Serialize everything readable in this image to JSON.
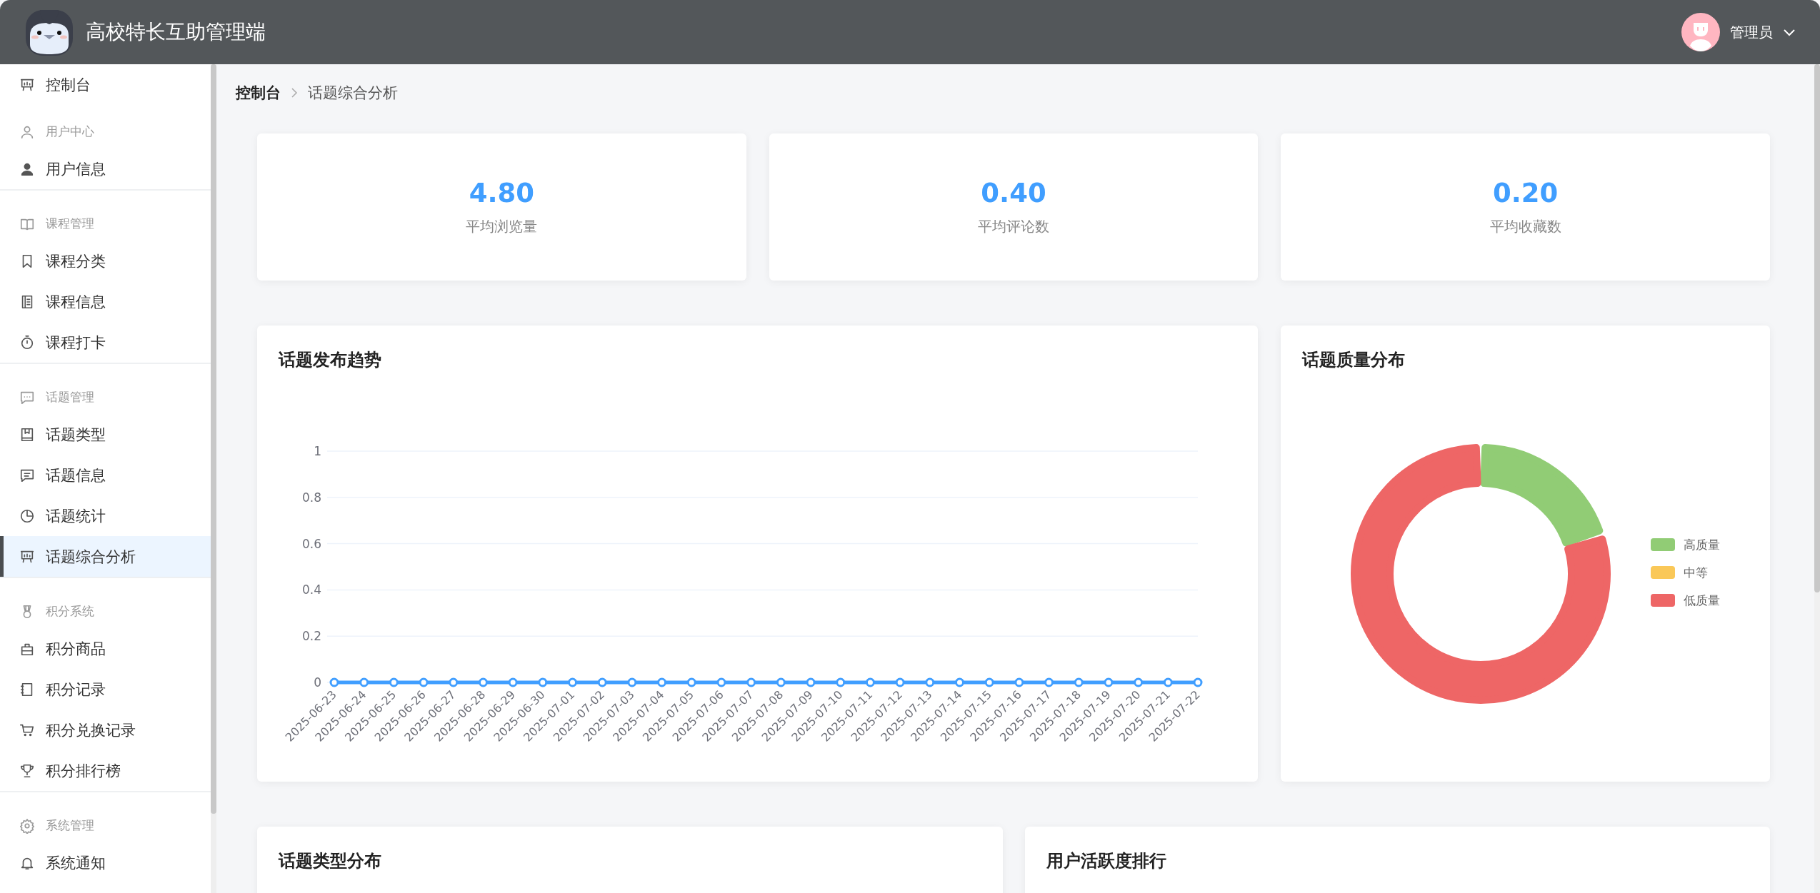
{
  "header": {
    "title": "高校特长互助管理端",
    "user": {
      "name": "管理员"
    }
  },
  "sidebar": {
    "items": [
      {
        "kind": "item",
        "label": "控制台",
        "selected": false
      },
      {
        "kind": "group",
        "label": "用户中心",
        "children": [
          {
            "label": "用户信息",
            "selected": false
          }
        ]
      },
      {
        "kind": "group",
        "label": "课程管理",
        "children": [
          {
            "label": "课程分类",
            "selected": false
          },
          {
            "label": "课程信息",
            "selected": false
          },
          {
            "label": "课程打卡",
            "selected": false
          }
        ]
      },
      {
        "kind": "group",
        "label": "话题管理",
        "children": [
          {
            "label": "话题类型",
            "selected": false
          },
          {
            "label": "话题信息",
            "selected": false
          },
          {
            "label": "话题统计",
            "selected": false
          },
          {
            "label": "话题综合分析",
            "selected": true
          }
        ]
      },
      {
        "kind": "group",
        "label": "积分系统",
        "children": [
          {
            "label": "积分商品",
            "selected": false
          },
          {
            "label": "积分记录",
            "selected": false
          },
          {
            "label": "积分兑换记录",
            "selected": false
          },
          {
            "label": "积分排行榜",
            "selected": false
          }
        ]
      },
      {
        "kind": "group",
        "label": "系统管理",
        "children": [
          {
            "label": "系统通知",
            "selected": false
          }
        ]
      }
    ]
  },
  "breadcrumb": [
    "控制台",
    "话题综合分析"
  ],
  "stats": [
    {
      "value": "4.80",
      "label": "平均浏览量"
    },
    {
      "value": "0.40",
      "label": "平均评论数"
    },
    {
      "value": "0.20",
      "label": "平均收藏数"
    }
  ],
  "trend": {
    "title": "话题发布趋势",
    "chart_data": {
      "type": "line",
      "categories": [
        "2025-06-23",
        "2025-06-24",
        "2025-06-25",
        "2025-06-26",
        "2025-06-27",
        "2025-06-28",
        "2025-06-29",
        "2025-06-30",
        "2025-07-01",
        "2025-07-02",
        "2025-07-03",
        "2025-07-04",
        "2025-07-05",
        "2025-07-06",
        "2025-07-07",
        "2025-07-08",
        "2025-07-09",
        "2025-07-10",
        "2025-07-11",
        "2025-07-12",
        "2025-07-13",
        "2025-07-14",
        "2025-07-15",
        "2025-07-16",
        "2025-07-17",
        "2025-07-18",
        "2025-07-19",
        "2025-07-20",
        "2025-07-21",
        "2025-07-22"
      ],
      "series": [
        {
          "color": "#409eff",
          "marker": true,
          "values": [
            0,
            0,
            0,
            0,
            0,
            0,
            0,
            0,
            0,
            0,
            0,
            0,
            0,
            0,
            0,
            0,
            0,
            0,
            0,
            0,
            0,
            0,
            0,
            0,
            0,
            0,
            0,
            0,
            0,
            0
          ]
        }
      ],
      "ylim": [
        0,
        1
      ],
      "yticks": [
        0,
        0.2,
        0.4,
        0.6,
        0.8,
        1
      ],
      "grid": true
    }
  },
  "quality": {
    "title": "话题质量分布",
    "chart_data": {
      "type": "donut",
      "categories": [
        "高质量",
        "中等",
        "低质量"
      ],
      "colors": [
        "#91cc75",
        "#fac858",
        "#ee6666"
      ],
      "values": [
        20,
        0,
        80
      ],
      "legend": "right"
    }
  },
  "bottom_cards": [
    {
      "title": "话题类型分布"
    },
    {
      "title": "用户活跃度排行"
    }
  ]
}
